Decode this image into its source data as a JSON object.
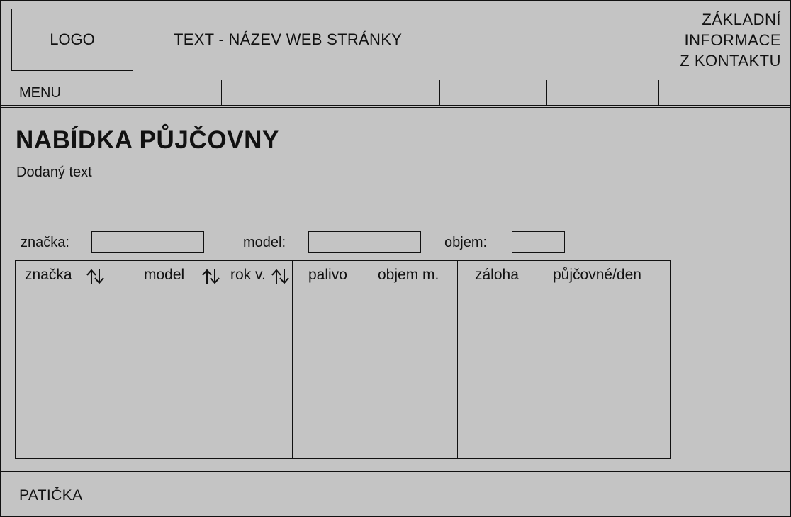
{
  "header": {
    "logo": "LOGO",
    "site_title": "TEXT - NÁZEV WEB STRÁNKY",
    "contact_lines": [
      "ZÁKLADNÍ",
      "INFORMACE",
      "Z KONTAKTU"
    ]
  },
  "menu": {
    "items": [
      "MENU",
      "",
      "",
      "",
      "",
      "",
      ""
    ]
  },
  "main": {
    "title": "NABÍDKA PŮJČOVNY",
    "description": "Dodaný text",
    "filters": [
      {
        "label": "značka:",
        "value": ""
      },
      {
        "label": "model:",
        "value": ""
      },
      {
        "label": "objem:",
        "value": ""
      }
    ],
    "table": {
      "columns": [
        {
          "label": "značka",
          "sortable": true
        },
        {
          "label": "model",
          "sortable": true
        },
        {
          "label": "rok v.",
          "sortable": true
        },
        {
          "label": "palivo",
          "sortable": false
        },
        {
          "label": "objem m.",
          "sortable": false
        },
        {
          "label": "záloha",
          "sortable": false
        },
        {
          "label": "půjčovné/den",
          "sortable": false
        }
      ],
      "rows": []
    }
  },
  "footer": {
    "text": "PATIČKA"
  },
  "icons": {
    "sort": "sort-up-down-arrows-icon"
  }
}
